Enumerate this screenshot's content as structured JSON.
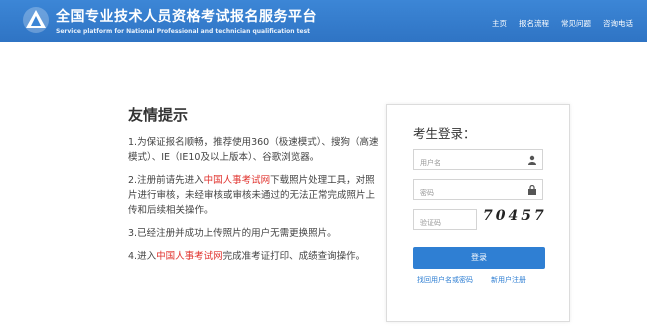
{
  "header": {
    "title": "全国专业技术人员资格考试报名服务平台",
    "subtitle": "Service platform for National Professional and technician qualification test",
    "nav": [
      "主页",
      "报名流程",
      "常见问题",
      "咨询电话"
    ]
  },
  "tips": {
    "title": "友情提示",
    "items": [
      {
        "text": "1.为保证报名顺畅，推荐使用360（极速模式）、搜狗（高速模式）、IE（IE10及以上版本）、谷歌浏览器。"
      },
      {
        "pre": "2.注册前请先进入",
        "link": "中国人事考试网",
        "post": "下载照片处理工具，对照片进行审核，未经审核或审核未通过的无法正常完成照片上传和后续相关操作。"
      },
      {
        "text": "3.已经注册并成功上传照片的用户无需更换照片。"
      },
      {
        "pre": "4.进入",
        "link": "中国人事考试网",
        "post": "完成准考证打印、成绩查询操作。"
      }
    ]
  },
  "login": {
    "title": "考生登录：",
    "username_placeholder": "用户名",
    "password_placeholder": "密码",
    "captcha_placeholder": "验证码",
    "captcha_text": "70457",
    "button": "登录",
    "forgot_link": "找回用户名或密码",
    "register_link": "新用户注册"
  },
  "colors": {
    "header": "#3c86d6",
    "accent": "#2f7fd3",
    "red": "#e0322d"
  }
}
